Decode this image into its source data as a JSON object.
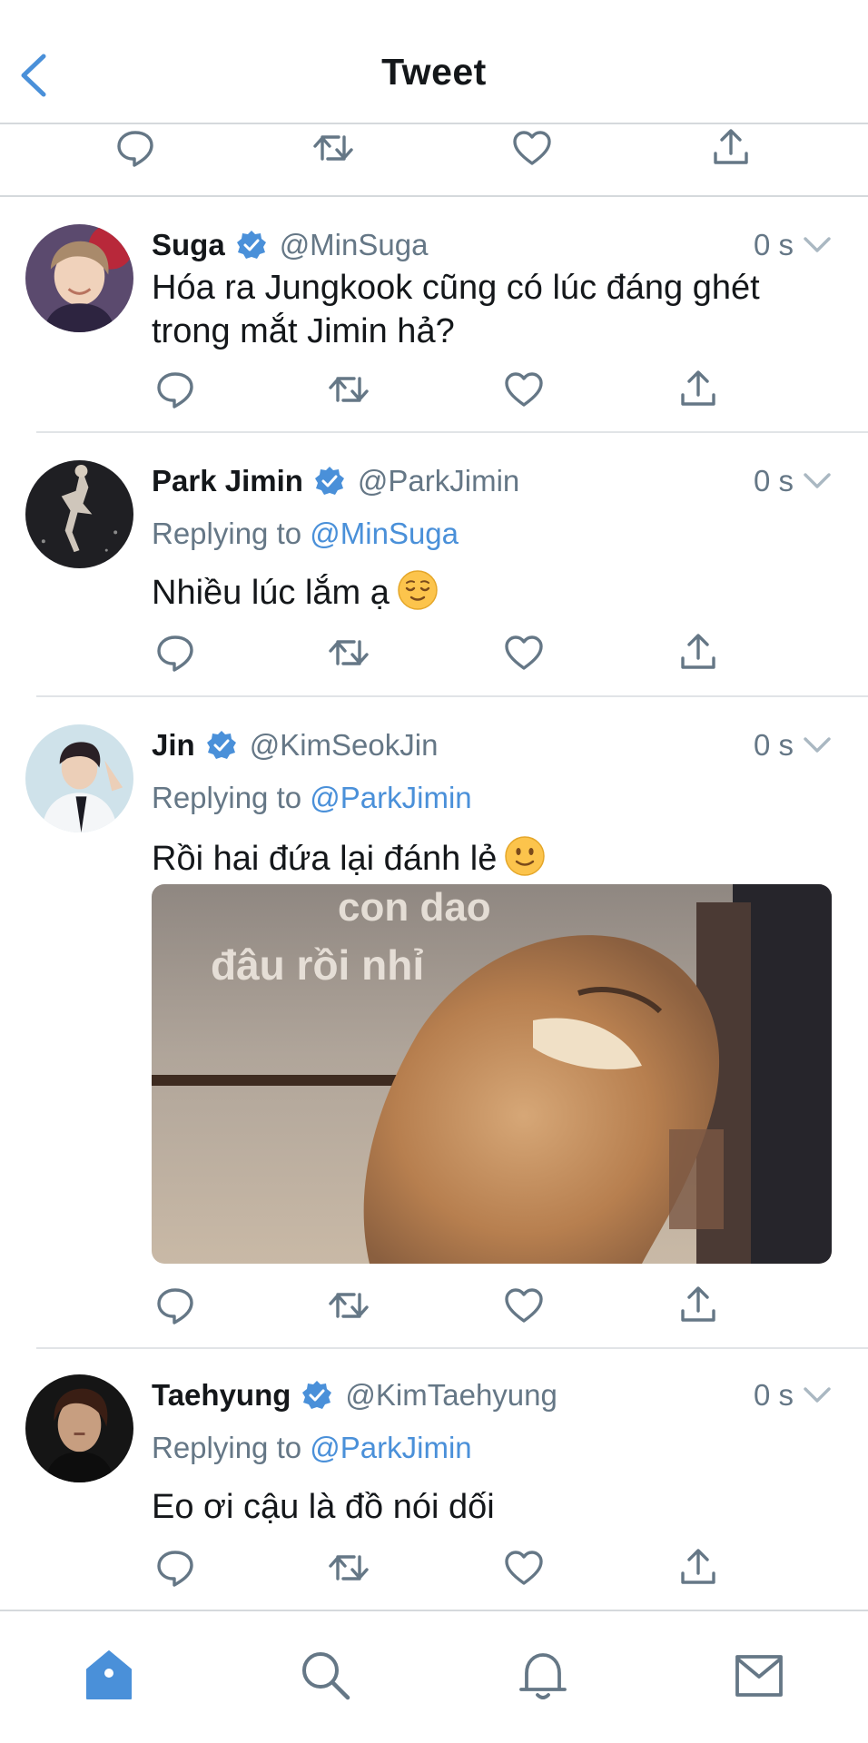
{
  "header": {
    "title": "Tweet",
    "back_icon": "chevron-left-icon"
  },
  "colors": {
    "accent": "#4a90d9",
    "secondary_text": "#657786",
    "divider": "#e1e4e7",
    "verified": "#4a90d9"
  },
  "tweets": [
    {
      "name": "Suga",
      "handle": "@MinSuga",
      "time": "0 s",
      "verified": true,
      "text": "Hóa ra Jungkook cũng có lúc đáng ghét trong mắt Jimin hả?"
    },
    {
      "name": "Park Jimin",
      "handle": "@ParkJimin",
      "time": "0 s",
      "verified": true,
      "replying_prefix": "Replying to ",
      "replying_to": "@MinSuga",
      "text": "Nhiều lúc lắm ạ",
      "emoji": "relieved-face"
    },
    {
      "name": "Jin",
      "handle": "@KimSeokJin",
      "time": "0 s",
      "verified": true,
      "replying_prefix": "Replying to ",
      "replying_to": "@ParkJimin",
      "text": "Rồi hai đứa lại đánh lẻ",
      "emoji": "slightly-smiling-face",
      "media": {
        "caption_line1": "con dao",
        "caption_line2": "đâu rồi nhỉ"
      }
    },
    {
      "name": "Taehyung",
      "handle": "@KimTaehyung",
      "time": "0 s",
      "verified": true,
      "replying_prefix": "Replying to ",
      "replying_to": "@ParkJimin",
      "text": "Eo ơi cậu là đồ nói dối"
    }
  ],
  "tabbar": {
    "items": [
      "home-icon",
      "search-icon",
      "bell-icon",
      "mail-icon"
    ],
    "active": "home-icon"
  }
}
